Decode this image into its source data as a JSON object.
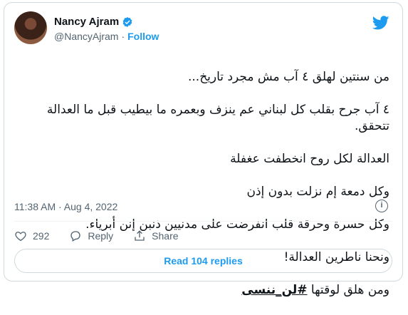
{
  "author": {
    "name": "Nancy Ajram",
    "handle": "@NancyAjram",
    "separator": "·",
    "follow_label": "Follow",
    "verified": true
  },
  "tweet": {
    "lines": [
      "من سنتين لهلق ٤ آب مش مجرد تاريخ...",
      "٤ آب جرح بقلب كل لبناني عم ينزف  وبعمره ما بيطيب قبل ما العدالة تتحقق.",
      "العدالة لكل روح انخطفت عغفلة",
      "وكل دمعة إم نزلت بدون إذن",
      "وكل حسرة وحرقة قلب انفرضت على مدنيين ذنبن إنن أبرياء.",
      "ونحنا ناطرين العدالة!"
    ],
    "last_line_prefix": "ومن هلق لوقتها ",
    "hashtag": "#لن_ننسى"
  },
  "meta": {
    "timestamp": "11:38 AM · Aug 4, 2022",
    "info_icon": "info-icon"
  },
  "actions": {
    "like_count": "292",
    "reply_label": "Reply",
    "share_label": "Share"
  },
  "read_replies_label": "Read 104 replies",
  "colors": {
    "accent": "#1d9bf0",
    "text": "#0f1419",
    "muted": "#536471",
    "border": "#cfd9de"
  }
}
